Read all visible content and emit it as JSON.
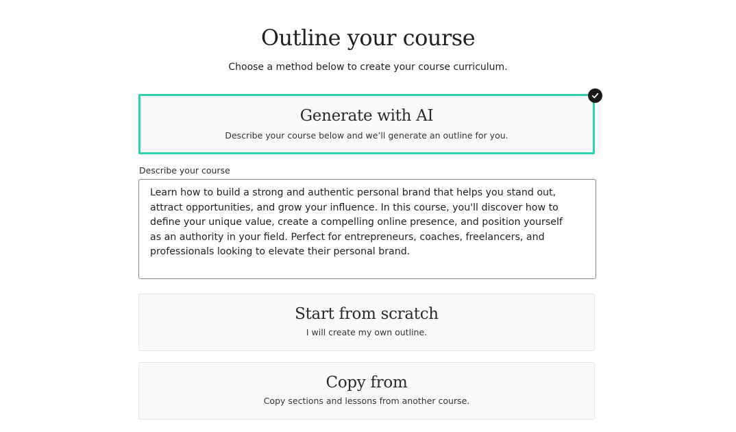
{
  "header": {
    "title": "Outline your course",
    "subtitle": "Choose a method below to create your course curriculum."
  },
  "options": [
    {
      "title": "Generate with AI",
      "description": "Describe your course below and we’ll generate an outline for you.",
      "selected": true
    },
    {
      "title": "Start from scratch",
      "description": "I will create my own outline.",
      "selected": false
    },
    {
      "title": "Copy from",
      "description": "Copy sections and lessons from another course.",
      "selected": false
    }
  ],
  "describe": {
    "label": "Describe your course",
    "value": "Learn how to build a strong and authentic personal brand that helps you stand out, attract opportunities, and grow your influence. In this course, you'll discover how to define your unique value, create a compelling online presence, and position yourself as an authority in your field. Perfect for entrepreneurs, coaches, freelancers, and professionals looking to elevate their personal brand."
  },
  "icons": {
    "selected_badge": "check-circle-icon"
  },
  "colors": {
    "selected_border": "#2ed1b0",
    "badge": "#1a1a1a",
    "card_background": "#fafafa"
  }
}
